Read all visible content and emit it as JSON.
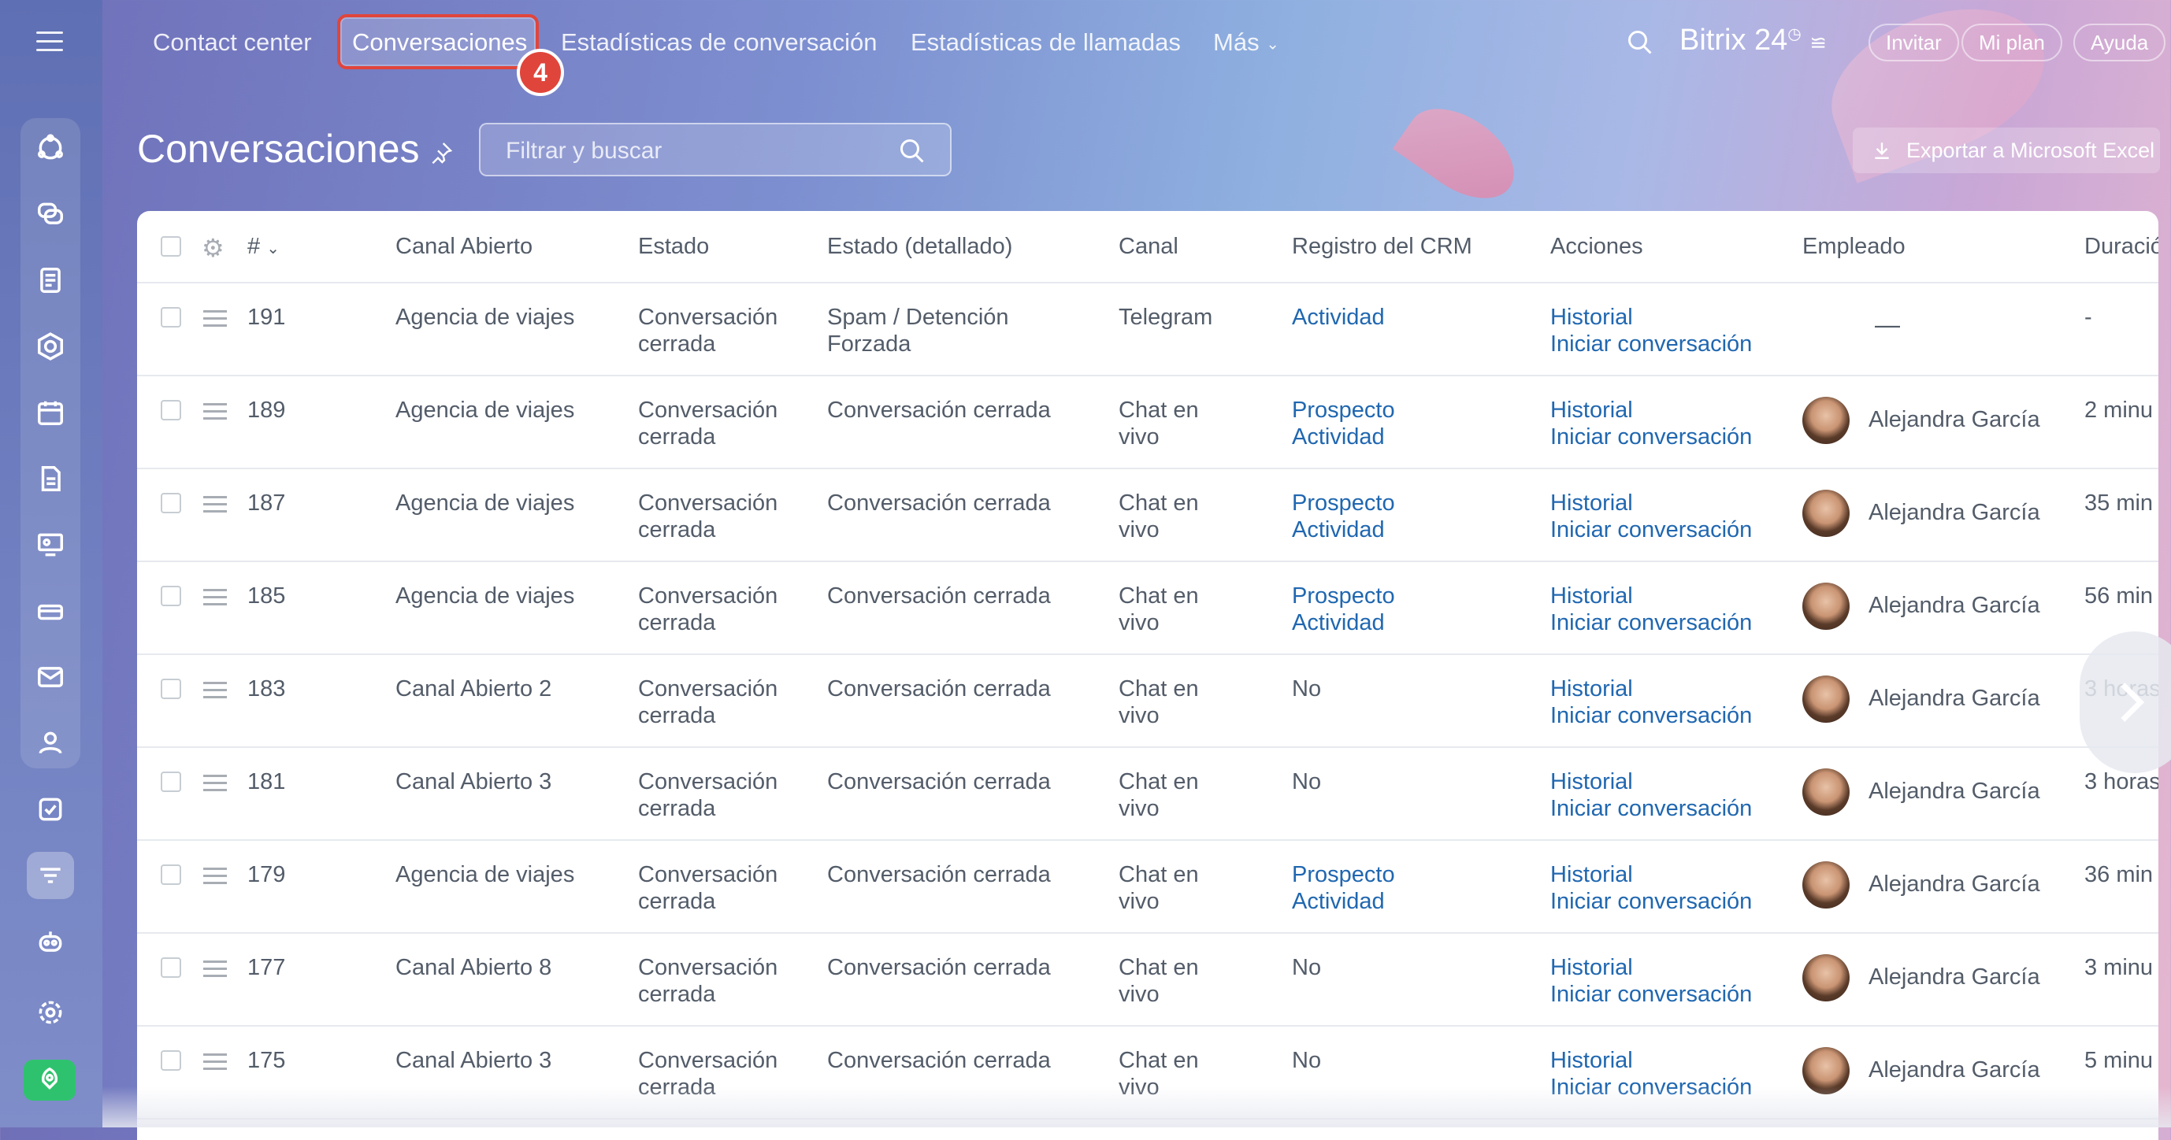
{
  "topnav": {
    "items": [
      "Contact center",
      "Conversaciones",
      "Estadísticas de conversación",
      "Estadísticas de llamadas",
      "Más"
    ],
    "active_index": 1,
    "step_badge": "4",
    "brand": "Bitrix 24",
    "buttons": [
      "Invitar",
      "Mi plan",
      "Ayuda"
    ]
  },
  "page": {
    "title": "Conversaciones",
    "search_placeholder": "Filtrar y buscar",
    "export_label": "Exportar a Microsoft Excel"
  },
  "grid": {
    "columns": [
      "#",
      "Canal Abierto",
      "Estado",
      "Estado (detallado)",
      "Canal",
      "Registro del CRM",
      "Acciones",
      "Empleado",
      "Duració"
    ],
    "rows": [
      {
        "id": "191",
        "canal": "Agencia de viajes",
        "estado": [
          "Conversación",
          "cerrada"
        ],
        "detalle": [
          "Spam / Detención",
          "Forzada"
        ],
        "tipo": [
          "Telegram",
          ""
        ],
        "crm": [
          "Actividad",
          ""
        ],
        "acciones": [
          "Historial",
          "Iniciar conversación"
        ],
        "empleado": "—",
        "duracion": "-"
      },
      {
        "id": "189",
        "canal": "Agencia de viajes",
        "estado": [
          "Conversación",
          "cerrada"
        ],
        "detalle": [
          "Conversación cerrada",
          ""
        ],
        "tipo": [
          "Chat en",
          "vivo"
        ],
        "crm": [
          "Prospecto",
          "Actividad"
        ],
        "acciones": [
          "Historial",
          "Iniciar conversación"
        ],
        "empleado": "Alejandra García",
        "duracion": "2 minu"
      },
      {
        "id": "187",
        "canal": "Agencia de viajes",
        "estado": [
          "Conversación",
          "cerrada"
        ],
        "detalle": [
          "Conversación cerrada",
          ""
        ],
        "tipo": [
          "Chat en",
          "vivo"
        ],
        "crm": [
          "Prospecto",
          "Actividad"
        ],
        "acciones": [
          "Historial",
          "Iniciar conversación"
        ],
        "empleado": "Alejandra García",
        "duracion": "35 min"
      },
      {
        "id": "185",
        "canal": "Agencia de viajes",
        "estado": [
          "Conversación",
          "cerrada"
        ],
        "detalle": [
          "Conversación cerrada",
          ""
        ],
        "tipo": [
          "Chat en",
          "vivo"
        ],
        "crm": [
          "Prospecto",
          "Actividad"
        ],
        "acciones": [
          "Historial",
          "Iniciar conversación"
        ],
        "empleado": "Alejandra García",
        "duracion": "56 min"
      },
      {
        "id": "183",
        "canal": "Canal Abierto 2",
        "estado": [
          "Conversación",
          "cerrada"
        ],
        "detalle": [
          "Conversación cerrada",
          ""
        ],
        "tipo": [
          "Chat en",
          "vivo"
        ],
        "crm": [
          "No",
          ""
        ],
        "acciones": [
          "Historial",
          "Iniciar conversación"
        ],
        "empleado": "Alejandra García",
        "duracion": "3 horas"
      },
      {
        "id": "181",
        "canal": "Canal Abierto 3",
        "estado": [
          "Conversación",
          "cerrada"
        ],
        "detalle": [
          "Conversación cerrada",
          ""
        ],
        "tipo": [
          "Chat en",
          "vivo"
        ],
        "crm": [
          "No",
          ""
        ],
        "acciones": [
          "Historial",
          "Iniciar conversación"
        ],
        "empleado": "Alejandra García",
        "duracion": "3 horas"
      },
      {
        "id": "179",
        "canal": "Agencia de viajes",
        "estado": [
          "Conversación",
          "cerrada"
        ],
        "detalle": [
          "Conversación cerrada",
          ""
        ],
        "tipo": [
          "Chat en",
          "vivo"
        ],
        "crm": [
          "Prospecto",
          "Actividad"
        ],
        "acciones": [
          "Historial",
          "Iniciar conversación"
        ],
        "empleado": "Alejandra García",
        "duracion": "36 min"
      },
      {
        "id": "177",
        "canal": "Canal Abierto 8",
        "estado": [
          "Conversación",
          "cerrada"
        ],
        "detalle": [
          "Conversación cerrada",
          ""
        ],
        "tipo": [
          "Chat en",
          "vivo"
        ],
        "crm": [
          "No",
          ""
        ],
        "acciones": [
          "Historial",
          "Iniciar conversación"
        ],
        "empleado": "Alejandra García",
        "duracion": "3 minu"
      },
      {
        "id": "175",
        "canal": "Canal Abierto 3",
        "estado": [
          "Conversación",
          "cerrada"
        ],
        "detalle": [
          "Conversación cerrada",
          ""
        ],
        "tipo": [
          "Chat en",
          "vivo"
        ],
        "crm": [
          "No",
          ""
        ],
        "acciones": [
          "Historial",
          "Iniciar conversación"
        ],
        "empleado": "Alejandra García",
        "duracion": "5 minu"
      }
    ]
  },
  "sidebar": {
    "icons": [
      "crm-icon",
      "chat-icon",
      "feed-icon",
      "sites-icon",
      "calendar-icon",
      "documents-icon",
      "training-icon",
      "inventory-icon",
      "mail-icon",
      "contacts-icon",
      "tasks-icon",
      "contact-center-icon",
      "bot-icon",
      "settings-icon",
      "rocket-icon"
    ],
    "active": "contact-center-icon"
  },
  "colors": {
    "accent": "#2067b0",
    "highlight": "#e0453b",
    "text": "#535c69",
    "green": "#2fc26e"
  }
}
